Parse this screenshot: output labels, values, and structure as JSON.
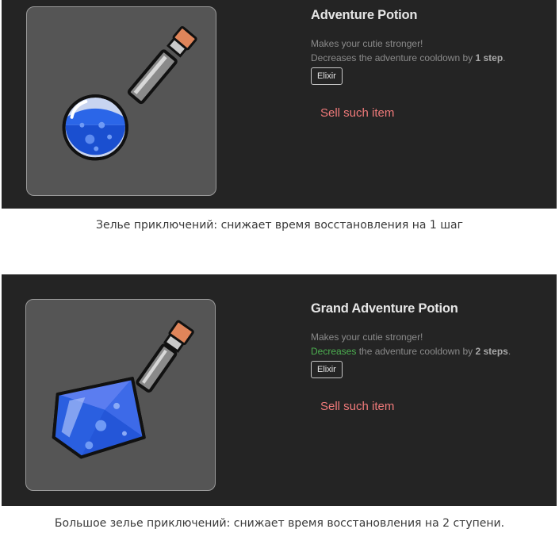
{
  "items": [
    {
      "title": "Adventure Potion",
      "desc_line1": "Makes your cutie stronger!",
      "desc_line2_pre": "",
      "desc_line2_highlight": "Decreases the adventure cooldown by ",
      "desc_line2_bold": "1 step",
      "desc_line2_post": ".",
      "badge": "Elixir",
      "sell_label": "Sell such item",
      "icon": "round-blue-potion-icon",
      "caption": "Зелье приключений: снижает время восстановления на 1 шаг"
    },
    {
      "title": "Grand Adventure Potion",
      "desc_line1": "Makes your cutie stronger!",
      "desc_line2_pre": "Decreases",
      "desc_line2_highlight": " the adventure cooldown by ",
      "desc_line2_bold": "2 steps",
      "desc_line2_post": ".",
      "badge": "Elixir",
      "sell_label": "Sell such item",
      "icon": "diamond-blue-potion-icon",
      "caption": "Большое зелье приключений: снижает время восстановления на 2 ступени."
    }
  ],
  "colors": {
    "panel_bg": "#242424",
    "image_bg": "#555555",
    "title": "#e6e6e6",
    "desc": "#8a8a8a",
    "highlight_green": "#4caf50",
    "sell": "#f07a7a",
    "potion_blue": "#1a4fd0",
    "cork": "#e0855a"
  }
}
